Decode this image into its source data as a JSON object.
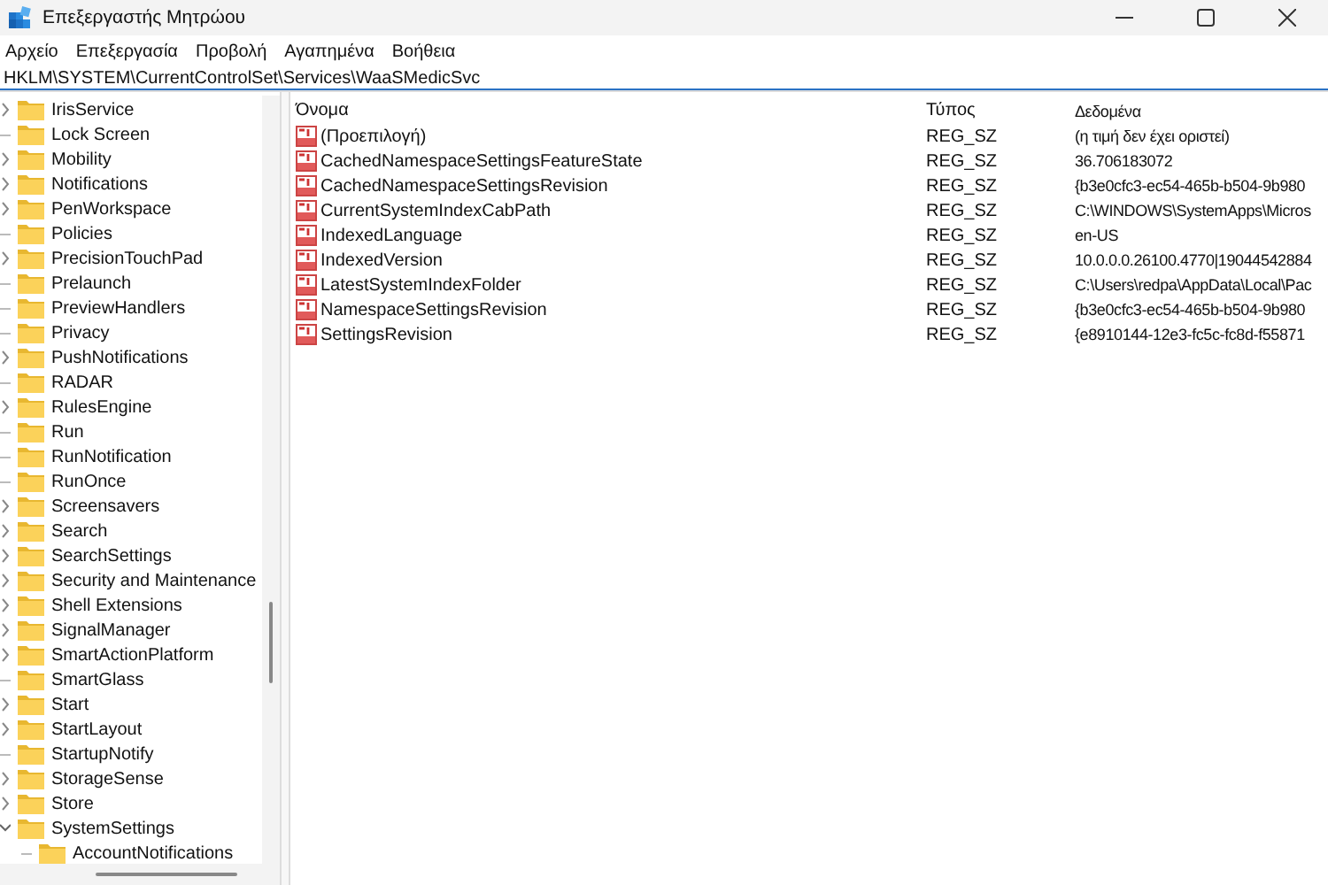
{
  "window": {
    "title": "Επεξεργαστής Μητρώου"
  },
  "menu": [
    "Αρχείο",
    "Επεξεργασία",
    "Προβολή",
    "Αγαπημένα",
    "Βοήθεια"
  ],
  "address": {
    "value": "HKLM\\SYSTEM\\CurrentControlSet\\Services\\WaaSMedicSvc"
  },
  "tree": [
    {
      "label": "IrisService",
      "has_children": true,
      "expanded": false
    },
    {
      "label": "Lock Screen",
      "has_children": false
    },
    {
      "label": "Mobility",
      "has_children": true,
      "expanded": false
    },
    {
      "label": "Notifications",
      "has_children": true,
      "expanded": false
    },
    {
      "label": "PenWorkspace",
      "has_children": true,
      "expanded": false
    },
    {
      "label": "Policies",
      "has_children": false
    },
    {
      "label": "PrecisionTouchPad",
      "has_children": true,
      "expanded": false
    },
    {
      "label": "Prelaunch",
      "has_children": false
    },
    {
      "label": "PreviewHandlers",
      "has_children": false
    },
    {
      "label": "Privacy",
      "has_children": false
    },
    {
      "label": "PushNotifications",
      "has_children": true,
      "expanded": false
    },
    {
      "label": "RADAR",
      "has_children": false
    },
    {
      "label": "RulesEngine",
      "has_children": true,
      "expanded": false
    },
    {
      "label": "Run",
      "has_children": false
    },
    {
      "label": "RunNotification",
      "has_children": false
    },
    {
      "label": "RunOnce",
      "has_children": false
    },
    {
      "label": "Screensavers",
      "has_children": true,
      "expanded": false
    },
    {
      "label": "Search",
      "has_children": true,
      "expanded": false
    },
    {
      "label": "SearchSettings",
      "has_children": true,
      "expanded": false
    },
    {
      "label": "Security and Maintenance",
      "has_children": true,
      "expanded": false
    },
    {
      "label": "Shell Extensions",
      "has_children": true,
      "expanded": false
    },
    {
      "label": "SignalManager",
      "has_children": true,
      "expanded": false
    },
    {
      "label": "SmartActionPlatform",
      "has_children": true,
      "expanded": false
    },
    {
      "label": "SmartGlass",
      "has_children": false
    },
    {
      "label": "Start",
      "has_children": true,
      "expanded": false
    },
    {
      "label": "StartLayout",
      "has_children": true,
      "expanded": false
    },
    {
      "label": "StartupNotify",
      "has_children": false
    },
    {
      "label": "StorageSense",
      "has_children": true,
      "expanded": false
    },
    {
      "label": "Store",
      "has_children": true,
      "expanded": false
    },
    {
      "label": "SystemSettings",
      "has_children": true,
      "expanded": true,
      "children": [
        {
          "label": "AccountNotifications",
          "has_children": false
        }
      ]
    }
  ],
  "table": {
    "columns": [
      "Όνομα",
      "Τύπος",
      "Δεδομένα"
    ],
    "rows": [
      {
        "name": "(Προεπιλογή)",
        "type": "REG_SZ",
        "data": "(η τιμή δεν έχει οριστεί)"
      },
      {
        "name": "CachedNamespaceSettingsFeatureState",
        "type": "REG_SZ",
        "data": "36.706183072"
      },
      {
        "name": "CachedNamespaceSettingsRevision",
        "type": "REG_SZ",
        "data": "{b3e0cfc3-ec54-465b-b504-9b980"
      },
      {
        "name": "CurrentSystemIndexCabPath",
        "type": "REG_SZ",
        "data": "C:\\WINDOWS\\SystemApps\\Micros"
      },
      {
        "name": "IndexedLanguage",
        "type": "REG_SZ",
        "data": "en-US"
      },
      {
        "name": "IndexedVersion",
        "type": "REG_SZ",
        "data": "10.0.0.0.26100.4770|19044542884"
      },
      {
        "name": "LatestSystemIndexFolder",
        "type": "REG_SZ",
        "data": "C:\\Users\\redpa\\AppData\\Local\\Pac"
      },
      {
        "name": "NamespaceSettingsRevision",
        "type": "REG_SZ",
        "data": "{b3e0cfc3-ec54-465b-b504-9b980"
      },
      {
        "name": "SettingsRevision",
        "type": "REG_SZ",
        "data": "{e8910144-12e3-fc5c-fc8d-f55871"
      }
    ]
  }
}
